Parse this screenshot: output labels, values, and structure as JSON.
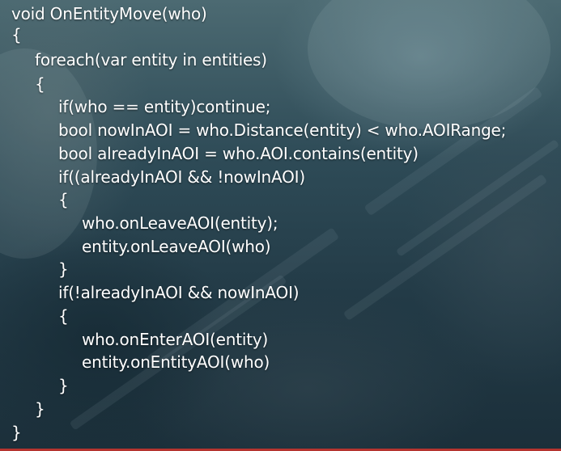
{
  "code": {
    "lines": [
      "void OnEntityMove(who)",
      "{",
      "foreach(var entity in entities)",
      "{",
      "if(who == entity)continue;",
      "bool nowInAOI = who.Distance(entity) < who.AOIRange;",
      "bool alreadyInAOI = who.AOI.contains(entity)",
      "if((alreadyInAOI && !nowInAOI)",
      "{",
      "who.onLeaveAOI(entity);",
      "entity.onLeaveAOI(who)",
      "}",
      "if(!alreadyInAOI && nowInAOI)",
      "{",
      "who.onEnterAOI(entity)",
      "entity.onEntityAOI(who)",
      "}",
      "}",
      "}"
    ]
  },
  "colors": {
    "text": "#ffffff",
    "accent": "#b5342f"
  }
}
